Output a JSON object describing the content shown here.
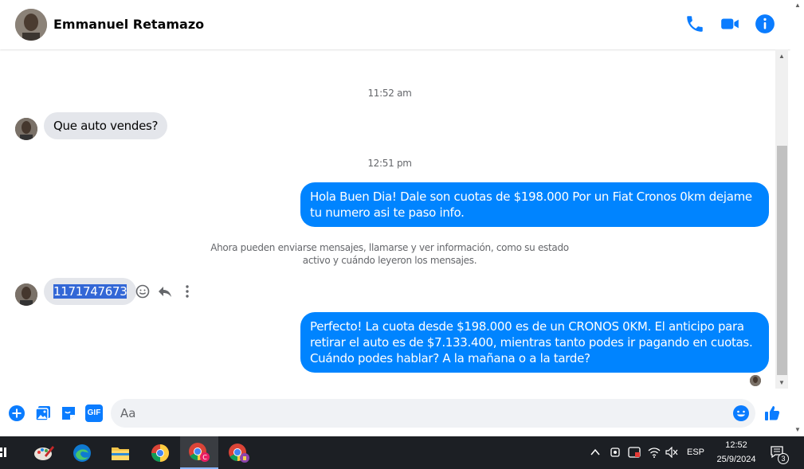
{
  "header": {
    "contact_name": "Emmanuel Retamazo"
  },
  "messages": {
    "timestamp_1": "11:52 am",
    "incoming_1": "Que auto vendes?",
    "timestamp_2": "12:51 pm",
    "outgoing_1": "Hola Buen Dia! Dale son cuotas de $198.000 Por un Fiat Cronos 0km dejame tu numero asi te paso info.",
    "system_note": "Ahora pueden enviarse mensajes, llamarse y ver información, como su estado activo y cuándo leyeron los mensajes.",
    "incoming_2": "1171747673",
    "outgoing_2": "Perfecto! La cuota desde $198.000 es de un CRONOS 0KM. El anticipo para retirar el auto es de $7.133.400, mientras tanto podes ir pagando en cuotas. Cuándo podes hablar? A la mañana o a la tarde?"
  },
  "composer": {
    "placeholder": "Aa",
    "gif_label": "GIF"
  },
  "taskbar": {
    "language": "ESP",
    "time": "12:52",
    "date": "25/9/2024",
    "notification_count": "3"
  },
  "colors": {
    "messenger_blue": "#0084ff",
    "incoming_bubble": "#e4e6eb",
    "taskbar_bg": "#1c1f24"
  },
  "icons": {
    "header": [
      "phone-icon",
      "video-icon",
      "info-icon"
    ],
    "composer": [
      "plus-icon",
      "image-icon",
      "sticker-icon",
      "gif-icon",
      "emoji-icon",
      "like-icon"
    ],
    "message_actions": [
      "react-icon",
      "reply-icon",
      "more-icon"
    ]
  }
}
